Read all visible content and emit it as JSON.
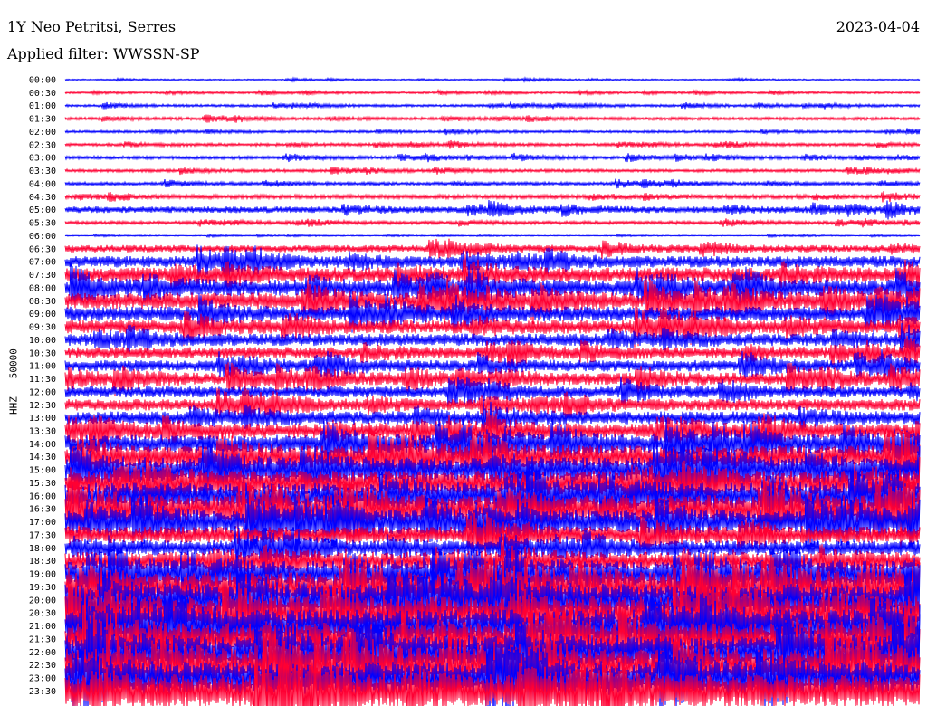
{
  "header": {
    "station": "1Y Neo Petritsi, Serres",
    "date": "2023-04-04",
    "filter": "Applied filter: WWSSN-SP"
  },
  "chart_data": {
    "type": "line",
    "title": "1Y Neo Petritsi, Serres",
    "subtitle": "Applied filter: WWSSN-SP",
    "ylabel": "HHZ - 50000",
    "xlabel": "",
    "row_labels": [
      "00:00",
      "00:30",
      "01:00",
      "01:30",
      "02:00",
      "02:30",
      "03:00",
      "03:30",
      "04:00",
      "04:30",
      "05:00",
      "05:30",
      "06:00",
      "06:30",
      "07:00",
      "07:30",
      "08:00",
      "08:30",
      "09:00",
      "09:30",
      "10:00",
      "10:30",
      "11:00",
      "11:30",
      "12:00",
      "12:30",
      "13:00",
      "13:30",
      "14:00",
      "14:30",
      "15:00",
      "15:30",
      "16:00",
      "16:30",
      "17:00",
      "17:30",
      "18:00",
      "18:30",
      "19:00",
      "19:30",
      "20:00",
      "20:30",
      "21:00",
      "21:30",
      "22:00",
      "22:30",
      "23:00",
      "23:30"
    ],
    "row_colors": [
      "#0000ff",
      "#ff0033"
    ],
    "amplitude_level": [
      0.08,
      0.12,
      0.15,
      0.18,
      0.15,
      0.18,
      0.2,
      0.18,
      0.2,
      0.25,
      0.4,
      0.2,
      0.06,
      0.45,
      0.7,
      0.9,
      1.0,
      1.0,
      0.9,
      0.85,
      0.75,
      0.7,
      0.7,
      0.75,
      0.7,
      0.7,
      0.8,
      0.9,
      1.1,
      1.4,
      1.5,
      1.5,
      1.6,
      1.7,
      1.4,
      1.0,
      0.9,
      1.1,
      1.6,
      1.8,
      2.0,
      2.0,
      2.0,
      2.0,
      2.0,
      2.0,
      2.0,
      2.0
    ],
    "grid": false
  }
}
